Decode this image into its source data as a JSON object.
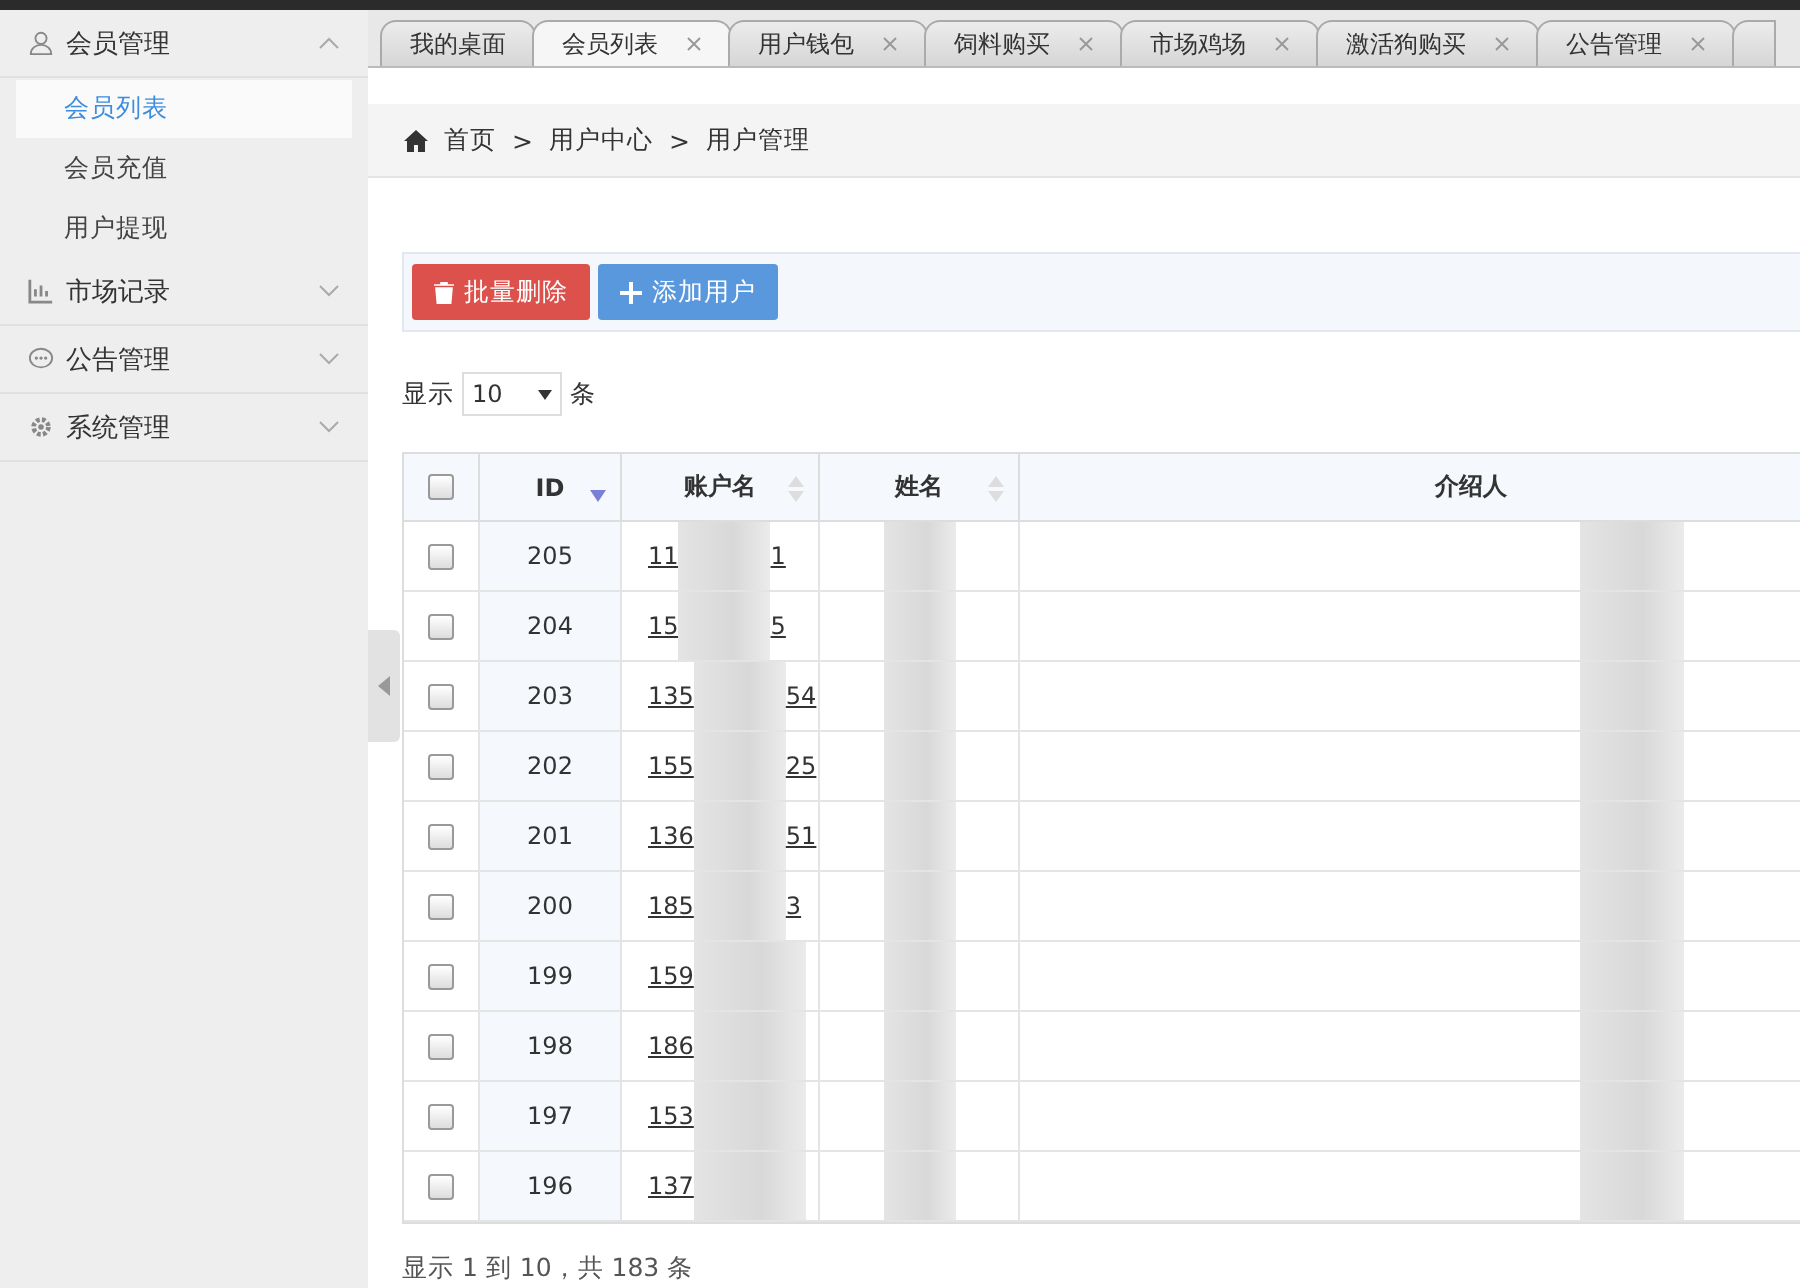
{
  "sidebar": {
    "groups": [
      {
        "label": "会员管理",
        "expanded": true,
        "items": [
          {
            "label": "会员列表",
            "selected": true
          },
          {
            "label": "会员充值",
            "selected": false
          },
          {
            "label": "用户提现",
            "selected": false
          }
        ]
      },
      {
        "label": "市场记录",
        "expanded": false
      },
      {
        "label": "公告管理",
        "expanded": false
      },
      {
        "label": "系统管理",
        "expanded": false
      }
    ]
  },
  "tabs": [
    {
      "label": "我的桌面",
      "selected": false,
      "closable": false
    },
    {
      "label": "会员列表",
      "selected": true,
      "closable": true
    },
    {
      "label": "用户钱包",
      "selected": false,
      "closable": true
    },
    {
      "label": "饲料购买",
      "selected": false,
      "closable": true
    },
    {
      "label": "市场鸡场",
      "selected": false,
      "closable": true
    },
    {
      "label": "激活狗购买",
      "selected": false,
      "closable": true
    },
    {
      "label": "公告管理",
      "selected": false,
      "closable": true
    }
  ],
  "breadcrumb": [
    "首页",
    "用户中心",
    "用户管理"
  ],
  "breadcrumb_separator": ">",
  "toolbar": [
    {
      "label": "批量删除",
      "kind": "danger"
    },
    {
      "label": "添加用户",
      "kind": "primary"
    }
  ],
  "page_size": {
    "prefix": "显示",
    "value": "10",
    "suffix": "条"
  },
  "table": {
    "select_all_checked": false,
    "columns": [
      {
        "label": "ID"
      },
      {
        "label": "账户名"
      },
      {
        "label": "姓名"
      },
      {
        "label": "介绍人"
      }
    ],
    "rows": [
      {
        "id": "205",
        "account_start": "11",
        "account_end": "1",
        "checked": false
      },
      {
        "id": "204",
        "account_start": "15",
        "account_end": "5",
        "checked": false
      },
      {
        "id": "203",
        "account_start": "135",
        "account_end": "54",
        "checked": false
      },
      {
        "id": "202",
        "account_start": "155",
        "account_end": "25",
        "checked": false
      },
      {
        "id": "201",
        "account_start": "136",
        "account_end": "51",
        "checked": false
      },
      {
        "id": "200",
        "account_start": "185",
        "account_end": "3",
        "checked": false
      },
      {
        "id": "199",
        "account_start": "159",
        "checked": false
      },
      {
        "id": "198",
        "account_start": "186",
        "checked": false
      },
      {
        "id": "197",
        "account_start": "153",
        "checked": false
      },
      {
        "id": "196",
        "account_start": "137",
        "checked": false
      }
    ]
  },
  "footer": "显示 1 到 10，共 183 条"
}
